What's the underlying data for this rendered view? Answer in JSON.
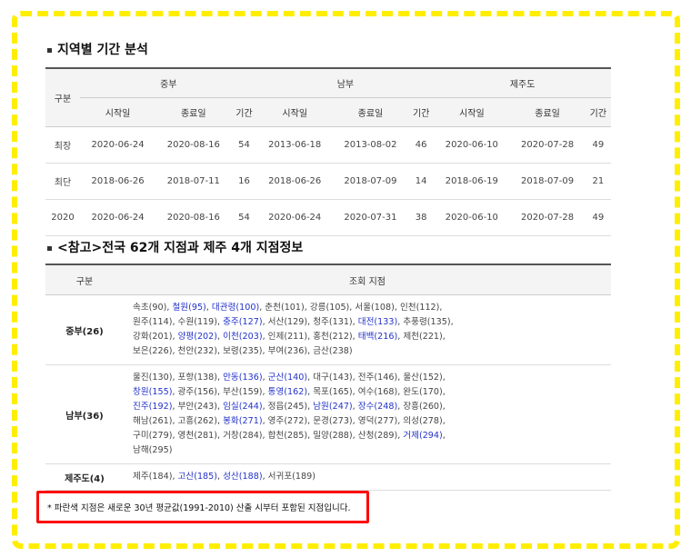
{
  "section1": {
    "title": "지역별 기간 분석"
  },
  "table1": {
    "col_group": "구분",
    "regions": [
      "중부",
      "남부",
      "제주도"
    ],
    "sub_headers": [
      "시작일",
      "종료일",
      "기간"
    ],
    "rows": [
      [
        "최장",
        "2020-06-24",
        "2020-08-16",
        "54",
        "2013-06-18",
        "2013-08-02",
        "46",
        "2020-06-10",
        "2020-07-28",
        "49"
      ],
      [
        "최단",
        "2018-06-26",
        "2018-07-11",
        "16",
        "2018-06-26",
        "2018-07-09",
        "14",
        "2018-06-19",
        "2018-07-09",
        "21"
      ],
      [
        "2020",
        "2020-06-24",
        "2020-08-16",
        "54",
        "2020-06-24",
        "2020-07-31",
        "38",
        "2020-06-10",
        "2020-07-28",
        "49"
      ]
    ]
  },
  "section2": {
    "title": "<참고>전국 62개 지점과 제주 4개 지점정보"
  },
  "table2": {
    "col1": "구분",
    "col2": "조회 지점",
    "rows": [
      {
        "label": "중부(26)",
        "lines": [
          [
            [
              "속초(90), ",
              false
            ],
            [
              "철원(95)",
              true
            ],
            [
              ", ",
              false
            ],
            [
              "대관령(100)",
              true
            ],
            [
              ", 춘천(101), 강릉(105), 서울(108), 인천(112),",
              false
            ]
          ],
          [
            [
              "원주(114), 수원(119), ",
              false
            ],
            [
              "충주(127)",
              true
            ],
            [
              ", 서산(129), 청주(131), ",
              false
            ],
            [
              "대전(133)",
              true
            ],
            [
              ", 추풍령(135),",
              false
            ]
          ],
          [
            [
              "강화(201), ",
              false
            ],
            [
              "양평(202)",
              true
            ],
            [
              ", ",
              false
            ],
            [
              "이천(203)",
              true
            ],
            [
              ", 인제(211), 홍천(212), ",
              false
            ],
            [
              "태백(216)",
              true
            ],
            [
              ", 제천(221),",
              false
            ]
          ],
          [
            [
              "보은(226), 천안(232), 보령(235), 부여(236), 금산(238)",
              false
            ]
          ]
        ]
      },
      {
        "label": "남부(36)",
        "lines": [
          [
            [
              "울진(130), 포항(138), ",
              false
            ],
            [
              "안동(136)",
              true
            ],
            [
              ", ",
              false
            ],
            [
              "군산(140)",
              true
            ],
            [
              ", 대구(143), 전주(146), 울산(152),",
              false
            ]
          ],
          [
            [
              "창원(155)",
              true
            ],
            [
              ", 광주(156), 부산(159), ",
              false
            ],
            [
              "통영(162)",
              true
            ],
            [
              ", 목포(165), 여수(168), 완도(170),",
              false
            ]
          ],
          [
            [
              "진주(192)",
              true
            ],
            [
              ", 부안(243), ",
              false
            ],
            [
              "임실(244)",
              true
            ],
            [
              ", 정읍(245), ",
              false
            ],
            [
              "남원(247)",
              true
            ],
            [
              ", ",
              false
            ],
            [
              "장수(248)",
              true
            ],
            [
              ", 장흥(260),",
              false
            ]
          ],
          [
            [
              "해남(261), 고흥(262), ",
              false
            ],
            [
              "봉화(271)",
              true
            ],
            [
              ", 영주(272), 문경(273), 영덕(277), 의성(278),",
              false
            ]
          ],
          [
            [
              "구미(279), 영천(281), 거창(284), 합천(285), 밀양(288), 산청(289), ",
              false
            ],
            [
              "거제(294)",
              true
            ],
            [
              ",",
              false
            ]
          ],
          [
            [
              "남해(295)",
              false
            ]
          ]
        ]
      },
      {
        "label": "제주도(4)",
        "lines": [
          [
            [
              "제주(184), ",
              false
            ],
            [
              "고산(185)",
              true
            ],
            [
              ", ",
              false
            ],
            [
              "성산(188)",
              true
            ],
            [
              ", 서귀포(189)",
              false
            ]
          ]
        ]
      }
    ]
  },
  "note": "* 파란색 지점은 새로운 30년 평균값(1991-2010) 산출 시부터 포함된 지점입니다.",
  "colors": {
    "highlight_blue": "#2332c8",
    "frame_yellow": "#ffee00",
    "note_border": "#ff0a0a"
  }
}
